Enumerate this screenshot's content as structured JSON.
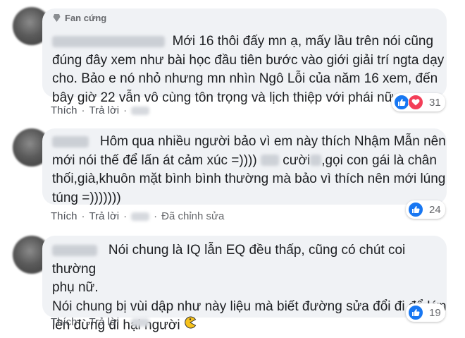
{
  "comments": [
    {
      "badge": "Fan cứng",
      "text": "Mới 16 thôi đấy mn ạ, mấy lầu trên nói cũng\nđúng đây xem như bài học đầu tiên bước vào giới giải trí ngta dạy\ncho. Bảo e nó nhỏ nhưng mn nhìn Ngô Lỗi của năm 16 xem, đến\nbây giờ 22 vẫn vô cùng tôn trọng và lịch thiệp với phái nữ",
      "reactions": [
        "like-icon",
        "love-icon"
      ],
      "reaction_count": "31",
      "like_label": "Thích",
      "reply_label": "Trả lời"
    },
    {
      "text_parts": [
        "Hôm qua nhiều người bảo vì em này thích Nhậm Mẫn nên\nmới nói thế để lấn át cảm xúc =))))",
        "cười",
        ",gọi con gái là chân\nthối,già,khuôn mặt bình bình thường mà bảo vì thích nên mới lúng\ntúng =)))))))"
      ],
      "reactions": [
        "like-icon"
      ],
      "reaction_count": "24",
      "like_label": "Thích",
      "reply_label": "Trả lời",
      "edited_label": "Đã chỉnh sửa"
    },
    {
      "text": "Nói chung là IQ lẫn EQ đều thấp, cũng có chút coi thường\nphụ nữ.\nNói chung bị vùi dập như này liệu mà biết đường sửa đổi đi để lớn\nlên đừng đi hại người",
      "emoji_icon": "pacman-icon",
      "reactions": [
        "like-icon"
      ],
      "reaction_count": "19",
      "like_label": "Thích",
      "reply_label": "Trả lời"
    }
  ],
  "colors": {
    "bubble": "#f0f2f5",
    "like": "#1877f2",
    "love": "#f33e58",
    "secondary_text": "#65676b"
  }
}
